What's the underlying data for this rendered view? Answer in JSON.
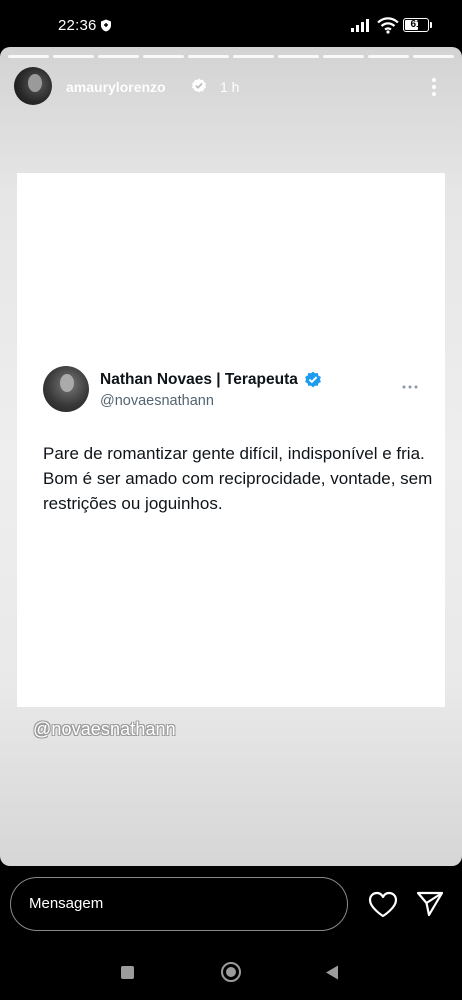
{
  "status_bar": {
    "time": "22:36",
    "battery_percent": "61",
    "battery_level": 0.61,
    "icons": [
      "shield-icon",
      "signal-icon",
      "wifi-icon",
      "battery-icon"
    ]
  },
  "story": {
    "progress_segments": 10,
    "username": "amaurylorenzo",
    "time_ago": "1 h",
    "mention_sticker": "@novaesnathann"
  },
  "tweet": {
    "name": "Nathan Novaes | Terapeuta",
    "handle": "@novaesnathann",
    "text": "Pare de romantizar gente difícil, indisponível e fria. Bom é ser amado com reciprocidade, vontade, sem restrições ou joguinhos.",
    "verified_color": "#1d9bf0"
  },
  "reply_bar": {
    "placeholder": "Mensagem",
    "icons": [
      "heart-icon",
      "send-icon"
    ]
  },
  "nav_bar": {
    "icons": [
      "recents-icon",
      "home-icon",
      "back-icon"
    ]
  }
}
